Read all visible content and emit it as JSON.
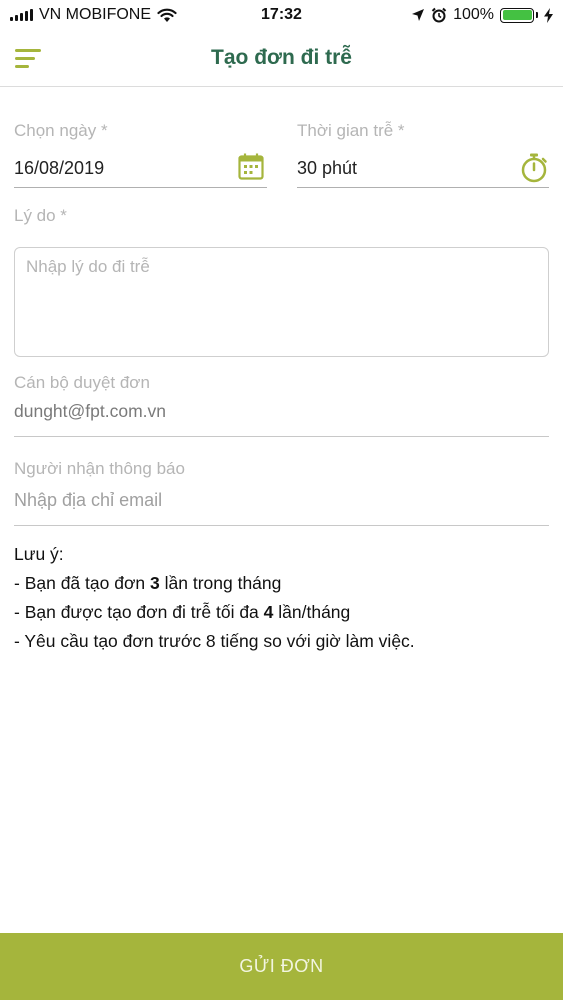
{
  "status_bar": {
    "carrier": "VN MOBIFONE",
    "time": "17:32",
    "battery": "100%",
    "battery_level": 1.0
  },
  "nav": {
    "title": "Tạo đơn đi trễ"
  },
  "form": {
    "date": {
      "label": "Chọn ngày *",
      "value": "16/08/2019"
    },
    "duration": {
      "label": "Thời gian trễ *",
      "value": "30 phút"
    },
    "reason": {
      "label": "Lý do *",
      "placeholder": "Nhập lý do đi trễ"
    },
    "approver": {
      "label": "Cán bộ duyệt đơn",
      "value": "dunght@fpt.com.vn"
    },
    "notify": {
      "label": "Người nhận thông báo",
      "placeholder": "Nhập địa chỉ email"
    }
  },
  "notes": {
    "title": "Lưu ý:",
    "line1_prefix": "- Bạn đã tạo đơn ",
    "line1_count": "3",
    "line1_suffix": " lần trong tháng",
    "line2_prefix": "- Bạn được tạo đơn đi trễ tối đa ",
    "line2_count": "4",
    "line2_suffix": " lần/tháng",
    "line3": "- Yêu cầu tạo đơn trước 8 tiếng so với giờ làm việc."
  },
  "submit": {
    "label": "GỬI ĐƠN"
  },
  "colors": {
    "accent": "#a5b53c",
    "title": "#2e6a4f",
    "battery": "#44c142"
  }
}
